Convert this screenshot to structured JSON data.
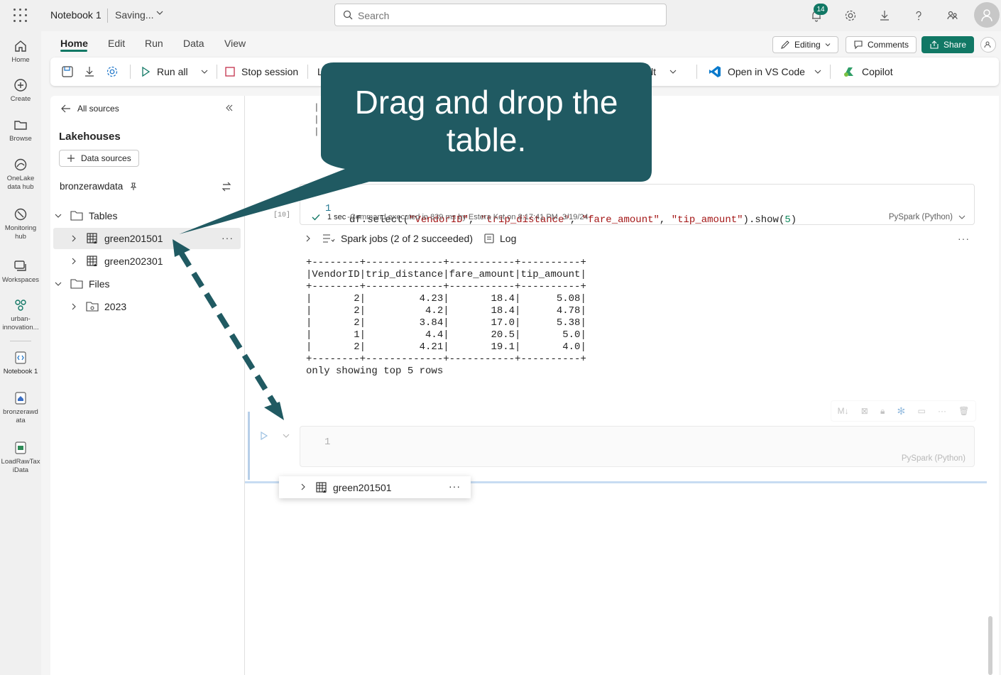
{
  "app": {
    "notebook_title": "Notebook 1",
    "save_status": "Saving...",
    "search_placeholder": "Search",
    "notification_count": "14"
  },
  "rail": [
    {
      "label": "Home",
      "icon": "home-icon"
    },
    {
      "label": "Create",
      "icon": "plus-circle-icon"
    },
    {
      "label": "Browse",
      "icon": "folder-icon"
    },
    {
      "label": "OneLake data hub",
      "icon": "onelake-icon"
    },
    {
      "label": "Monitoring hub",
      "icon": "monitor-icon"
    },
    {
      "label": "Workspaces",
      "icon": "workspaces-icon"
    },
    {
      "label": "urban-innovation...",
      "icon": "workspace-icon"
    },
    {
      "label": "Notebook 1",
      "icon": "notebook-icon"
    },
    {
      "label": "bronzerawdata",
      "icon": "lakehouse-icon"
    },
    {
      "label": "LoadRawTaxiData",
      "icon": "pipeline-icon"
    }
  ],
  "ribbon": {
    "tabs": [
      "Home",
      "Edit",
      "Run",
      "Data",
      "View"
    ],
    "editing_label": "Editing",
    "comments_label": "Comments",
    "share_label": "Share"
  },
  "toolbar": {
    "run_all": "Run all",
    "stop_session": "Stop session",
    "partial_label_l": "L",
    "partial_label_lt": "lt",
    "open_vscode": "Open in VS Code",
    "copilot": "Copilot"
  },
  "explorer": {
    "back_label": "All sources",
    "heading": "Lakehouses",
    "data_sources_label": "Data sources",
    "lakehouse_name": "bronzerawdata",
    "tables_label": "Tables",
    "tables": [
      "green201501",
      "green202301"
    ],
    "files_label": "Files",
    "files": [
      "2023"
    ]
  },
  "cell": {
    "line_number": "1",
    "exec_count": "[10]",
    "code_prefix": "df.select(",
    "args": [
      "\"VendorID\"",
      "\"trip_distance\"",
      "\"fare_amount\"",
      "\"tip_amount\""
    ],
    "code_mid": ").show(",
    "code_num": "5",
    "code_suffix": ")",
    "duration": "1 sec",
    "status": "-Command executed in 839 ms by Estera Kot on 8:17:41 PM, 3/19/24",
    "language": "PySpark (Python)",
    "spark_jobs": "Spark jobs (2 of 2 succeeded)",
    "log_label": "Log"
  },
  "output": {
    "table_text": "+--------+-------------+-----------+----------+\n|VendorID|trip_distance|fare_amount|tip_amount|\n+--------+-------------+-----------+----------+\n|       2|         4.23|       18.4|      5.08|\n|       2|          4.2|       18.4|      4.78|\n|       2|         3.84|       17.0|      5.38|\n|       1|          4.4|       20.5|       5.0|\n|       2|         4.21|       19.1|       4.0|\n+--------+-------------+-----------+----------+\nonly showing top 5 rows"
  },
  "cell2": {
    "line_number": "1",
    "language": "PySpark (Python)"
  },
  "drag": {
    "item": "green201501"
  },
  "callout": {
    "line1": "Drag and drop the",
    "line2": "table."
  },
  "colors": {
    "accent": "#117865",
    "callout": "#205a62"
  }
}
